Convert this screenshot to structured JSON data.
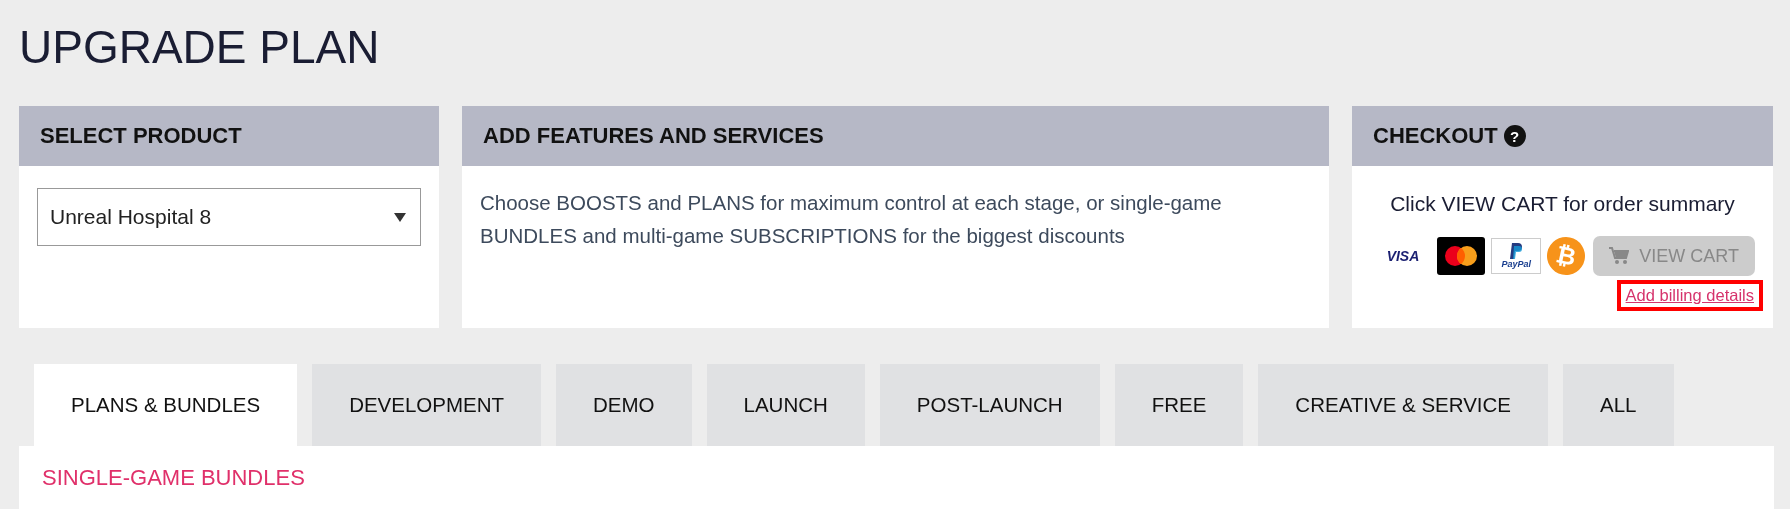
{
  "page_title": "UPGRADE PLAN",
  "select_product": {
    "title": "SELECT PRODUCT",
    "value": "Unreal Hospital 8"
  },
  "features": {
    "title": "ADD FEATURES AND SERVICES",
    "description": "Choose BOOSTS and PLANS for maximum control at each stage, or single-game BUNDLES and multi-game SUBSCRIPTIONS for the biggest discounts"
  },
  "checkout": {
    "title": "CHECKOUT",
    "help_icon": "?",
    "summary": "Click VIEW CART for order summary",
    "payment_methods": [
      {
        "kind": "visa",
        "label": "VISA"
      },
      {
        "kind": "mastercard"
      },
      {
        "kind": "paypal",
        "label": "PayPal"
      },
      {
        "kind": "bitcoin",
        "label": "₿"
      }
    ],
    "view_cart": {
      "label": "VIEW CART",
      "disabled": true
    },
    "billing_link": {
      "label": "Add billing details",
      "highlighted": true
    }
  },
  "tabs": [
    {
      "label": "PLANS & BUNDLES",
      "selected": true
    },
    {
      "label": "DEVELOPMENT",
      "selected": false
    },
    {
      "label": "DEMO",
      "selected": false
    },
    {
      "label": "LAUNCH",
      "selected": false
    },
    {
      "label": "POST-LAUNCH",
      "selected": false
    },
    {
      "label": "FREE",
      "selected": false
    },
    {
      "label": "CREATIVE & SERVICE",
      "selected": false
    },
    {
      "label": "ALL",
      "selected": false
    }
  ],
  "section_heading": "SINGLE-GAME BUNDLES"
}
